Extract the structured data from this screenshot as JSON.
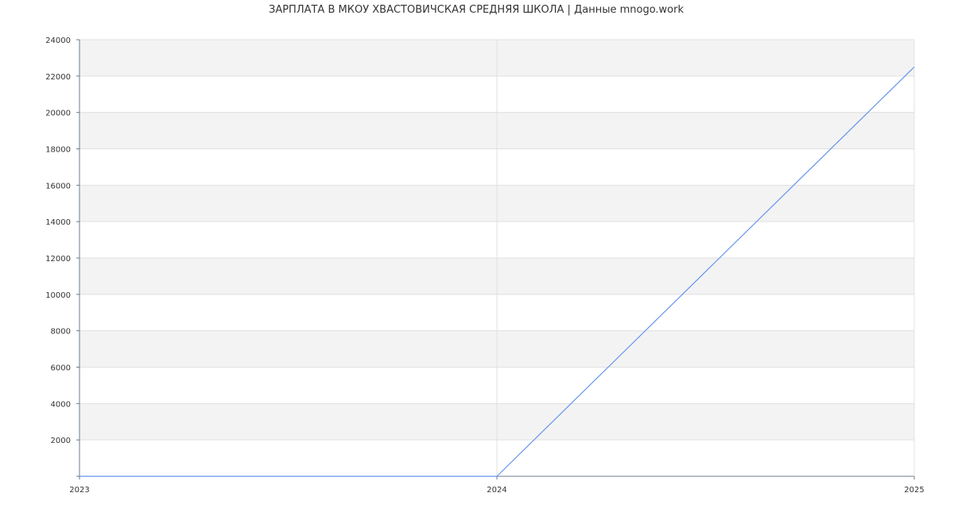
{
  "chart_data": {
    "type": "line",
    "title": "ЗАРПЛАТА В МКОУ ХВАСТОВИЧСКАЯ СРЕДНЯЯ ШКОЛА | Данные mnogo.work",
    "xlabel": "",
    "ylabel": "",
    "x": [
      "2023",
      "2024",
      "2025"
    ],
    "series": [
      {
        "values": [
          0,
          0,
          22500
        ]
      }
    ],
    "ylim": [
      0,
      24000
    ],
    "yticks": [
      2000,
      4000,
      6000,
      8000,
      10000,
      12000,
      14000,
      16000,
      18000,
      20000,
      22000,
      24000
    ],
    "grid": true,
    "legend": "none",
    "colors": {
      "line": "#6495ed",
      "band_alt": "#f3f3f3",
      "band": "#ffffff",
      "grid": "#e0e0e0",
      "axis": "#6b7b8c"
    }
  }
}
